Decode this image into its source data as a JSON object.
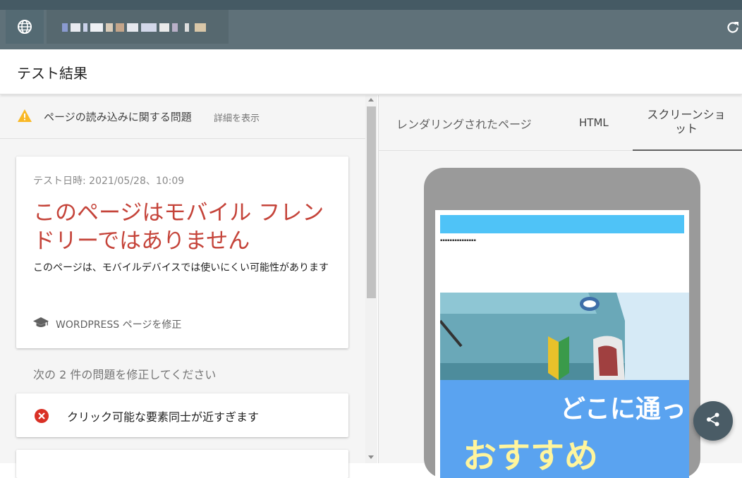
{
  "browser": {
    "url_text": "",
    "reload_icon": "reload-icon",
    "globe_icon": "globe-icon"
  },
  "header": {
    "title": "テスト結果"
  },
  "left": {
    "warning": {
      "icon": "warning-icon",
      "text": "ページの読み込みに関する問題",
      "link": "詳細を表示"
    },
    "result_card": {
      "test_date": "テスト日時: 2021/05/28、10:09",
      "verdict": "このページはモバイル フレンドリーではありません",
      "description": "このページは、モバイルデバイスでは使いにくい可能性があります",
      "wordpress_link": "WORDPRESS ページを修正"
    },
    "issues_heading": "次の 2 件の問題を修正してください",
    "issues": [
      {
        "icon": "error-icon",
        "label": "クリック可能な要素同士が近すぎます"
      }
    ]
  },
  "right": {
    "tabs": [
      {
        "label": "レンダリングされたページ"
      },
      {
        "label": "HTML"
      },
      {
        "label": "スクリーンショット"
      }
    ],
    "active_tab": 2,
    "screenshot": {
      "banner_line1": "どこに通っ",
      "banner_line2": "おすすめ"
    }
  },
  "share_fab_icon": "share-icon",
  "colors": {
    "verdict_red": "#c5443a",
    "toolbar": "#5f7179",
    "warning_yellow": "#f9b825",
    "error_red": "#d93025"
  }
}
